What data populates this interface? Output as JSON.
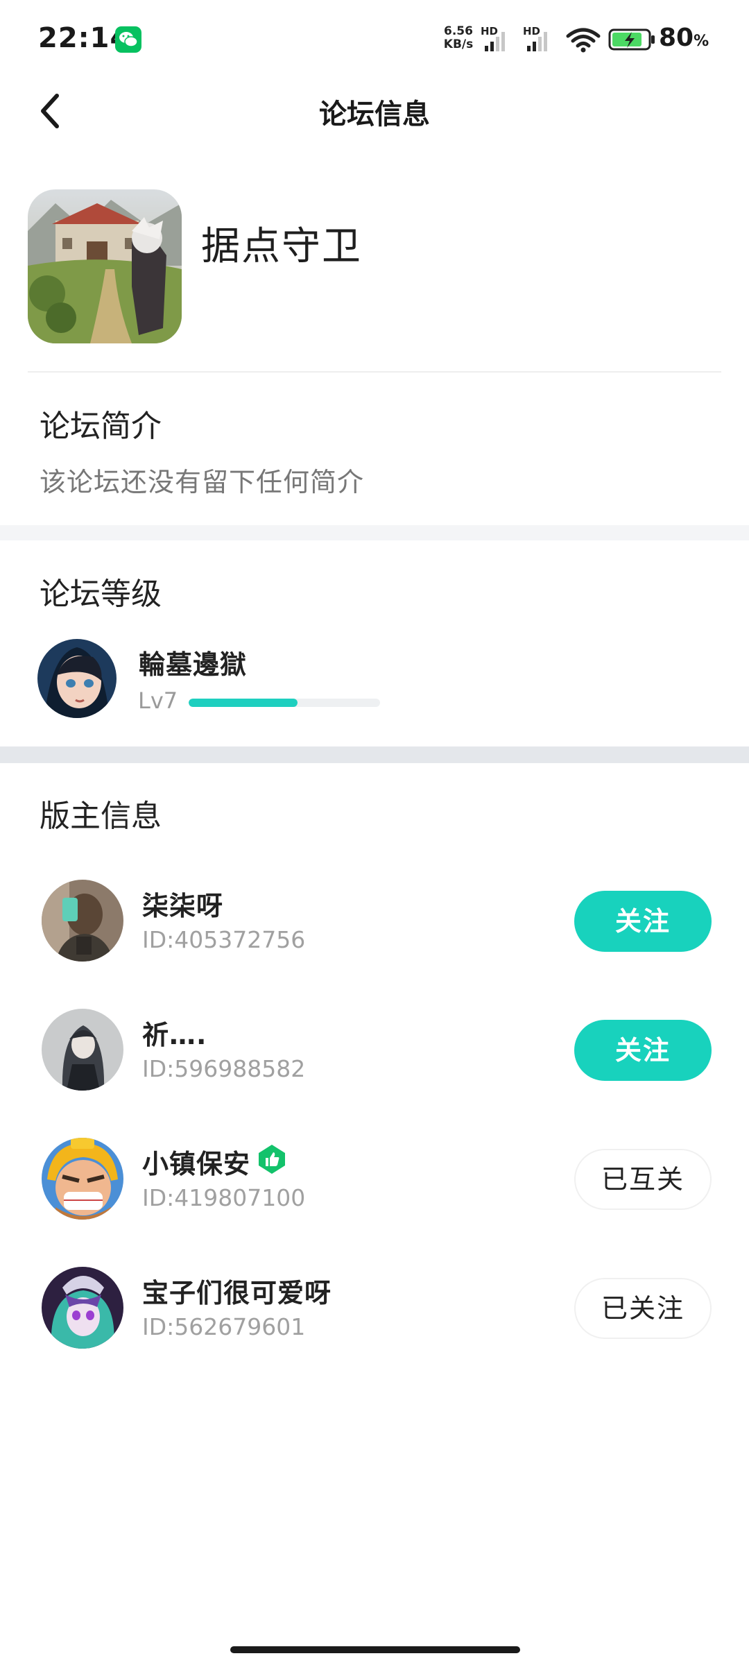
{
  "status_bar": {
    "time": "22:14",
    "net_speed_value": "6.56",
    "net_speed_unit": "KB/s",
    "sim1_label": "HD",
    "sim2_label": "HD",
    "battery_percent": "80",
    "battery_unit": "%"
  },
  "nav": {
    "title": "论坛信息"
  },
  "forum": {
    "name": "据点守卫"
  },
  "intro": {
    "title": "论坛简介",
    "text": "该论坛还没有留下任何简介"
  },
  "level": {
    "title": "论坛等级",
    "username": "輪墓邊獄",
    "level_label": "Lv7",
    "progress_fraction": 0.57
  },
  "moderators": {
    "title": "版主信息",
    "items": [
      {
        "name": "柒柒呀",
        "id": "ID:405372756",
        "button": "关注",
        "verified": false
      },
      {
        "name": "祈….",
        "id": "ID:596988582",
        "button": "关注",
        "verified": false
      },
      {
        "name": "小镇保安",
        "id": "ID:419807100",
        "button": "已互关",
        "verified": true
      },
      {
        "name": "宝子们很可爱呀",
        "id": "ID:562679601",
        "button": "已关注",
        "verified": false
      }
    ]
  },
  "colors": {
    "accent": "#18d2bd",
    "verified": "#13c26b",
    "muted_text": "#a0a0a0"
  }
}
